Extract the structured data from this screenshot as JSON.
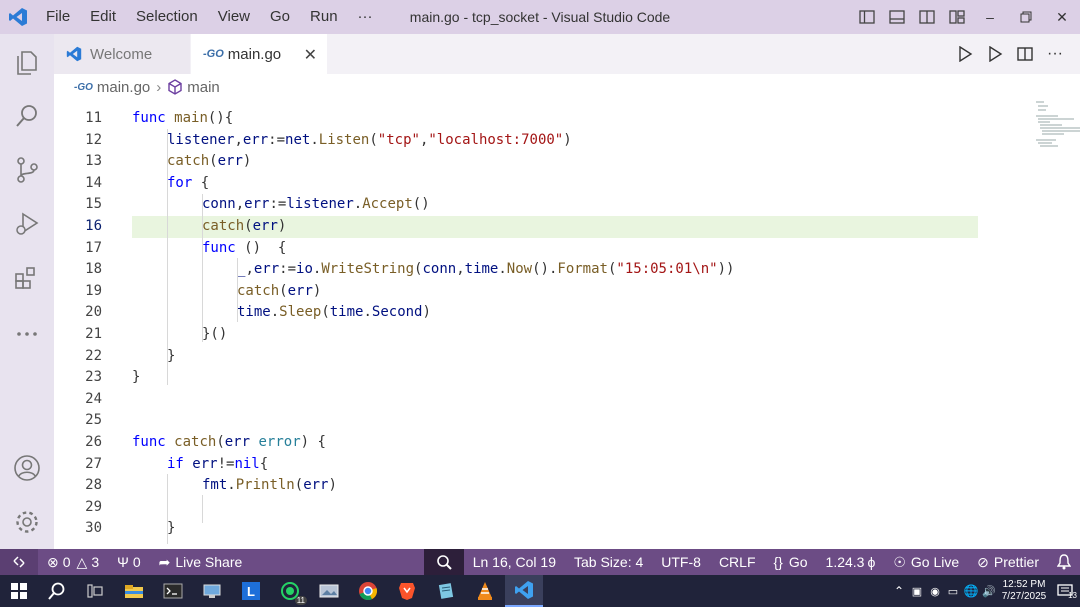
{
  "window": {
    "title": "main.go - tcp_socket - Visual Studio Code",
    "menu": [
      "File",
      "Edit",
      "Selection",
      "View",
      "Go",
      "Run",
      "···"
    ]
  },
  "tabs": [
    {
      "label": "Welcome",
      "active": false
    },
    {
      "label": "main.go",
      "active": true
    }
  ],
  "breadcrumb": {
    "file": "main.go",
    "symbol": "main"
  },
  "editor": {
    "active_line": 16,
    "lines": [
      {
        "n": "11",
        "indent": 0,
        "tokens": [
          [
            "kw",
            "func "
          ],
          [
            "fn",
            "main"
          ],
          [
            "",
            "(){"
          ]
        ]
      },
      {
        "n": "12",
        "indent": 1,
        "tokens": [
          [
            "var",
            "listener"
          ],
          [
            "",
            ","
          ],
          [
            "var",
            "err"
          ],
          [
            "",
            ":="
          ],
          [
            "var",
            "net"
          ],
          [
            "",
            "."
          ],
          [
            "fn",
            "Listen"
          ],
          [
            "",
            "("
          ],
          [
            "str",
            "\"tcp\""
          ],
          [
            "",
            ","
          ],
          [
            "str",
            "\"localhost:7000\""
          ],
          [
            "",
            ")"
          ]
        ]
      },
      {
        "n": "13",
        "indent": 1,
        "tokens": [
          [
            "fn",
            "catch"
          ],
          [
            "",
            "("
          ],
          [
            "var",
            "err"
          ],
          [
            "",
            ")"
          ]
        ]
      },
      {
        "n": "14",
        "indent": 1,
        "tokens": [
          [
            "kw",
            "for"
          ],
          [
            "",
            " {"
          ]
        ]
      },
      {
        "n": "15",
        "indent": 2,
        "tokens": [
          [
            "var",
            "conn"
          ],
          [
            "",
            ","
          ],
          [
            "var",
            "err"
          ],
          [
            "",
            ":="
          ],
          [
            "var",
            "listener"
          ],
          [
            "",
            "."
          ],
          [
            "fn",
            "Accept"
          ],
          [
            "",
            "()"
          ]
        ]
      },
      {
        "n": "16",
        "indent": 2,
        "tokens": [
          [
            "fn",
            "catch"
          ],
          [
            "",
            "("
          ],
          [
            "var",
            "err"
          ],
          [
            "",
            ")"
          ]
        ]
      },
      {
        "n": "17",
        "indent": 2,
        "tokens": [
          [
            "kw",
            "func"
          ],
          [
            "",
            " ()  {"
          ]
        ]
      },
      {
        "n": "18",
        "indent": 3,
        "tokens": [
          [
            "var",
            "_"
          ],
          [
            "",
            ","
          ],
          [
            "var",
            "err"
          ],
          [
            "",
            ":="
          ],
          [
            "var",
            "io"
          ],
          [
            "",
            "."
          ],
          [
            "fn",
            "WriteString"
          ],
          [
            "",
            "("
          ],
          [
            "var",
            "conn"
          ],
          [
            "",
            ","
          ],
          [
            "var",
            "time"
          ],
          [
            "",
            "."
          ],
          [
            "fn",
            "Now"
          ],
          [
            "",
            "()."
          ],
          [
            "fn",
            "Format"
          ],
          [
            "",
            "("
          ],
          [
            "str",
            "\"15:05:01\\n\""
          ],
          [
            "",
            "))"
          ]
        ]
      },
      {
        "n": "19",
        "indent": 3,
        "tokens": [
          [
            "fn",
            "catch"
          ],
          [
            "",
            "("
          ],
          [
            "var",
            "err"
          ],
          [
            "",
            ")"
          ]
        ]
      },
      {
        "n": "20",
        "indent": 3,
        "tokens": [
          [
            "var",
            "time"
          ],
          [
            "",
            "."
          ],
          [
            "fn",
            "Sleep"
          ],
          [
            "",
            "("
          ],
          [
            "var",
            "time"
          ],
          [
            "",
            "."
          ],
          [
            "var",
            "Second"
          ],
          [
            "",
            ")"
          ]
        ]
      },
      {
        "n": "21",
        "indent": 2,
        "tokens": [
          [
            "",
            "}()"
          ]
        ]
      },
      {
        "n": "22",
        "indent": 1,
        "tokens": [
          [
            "",
            "}"
          ]
        ]
      },
      {
        "n": "23",
        "indent": 0,
        "tokens": [
          [
            "",
            "}"
          ]
        ]
      },
      {
        "n": "24",
        "indent": 0,
        "tokens": []
      },
      {
        "n": "25",
        "indent": 0,
        "tokens": []
      },
      {
        "n": "26",
        "indent": 0,
        "tokens": [
          [
            "kw",
            "func "
          ],
          [
            "fn",
            "catch"
          ],
          [
            "",
            "("
          ],
          [
            "var",
            "err"
          ],
          [
            "",
            " "
          ],
          [
            "pkg",
            "error"
          ],
          [
            "",
            ") {"
          ]
        ]
      },
      {
        "n": "27",
        "indent": 1,
        "tokens": [
          [
            "kw",
            "if "
          ],
          [
            "var",
            "err"
          ],
          [
            "",
            "!="
          ],
          [
            "kw",
            "nil"
          ],
          [
            "",
            "{"
          ]
        ]
      },
      {
        "n": "28",
        "indent": 2,
        "tokens": [
          [
            "var",
            "fmt"
          ],
          [
            "",
            "."
          ],
          [
            "fn",
            "Println"
          ],
          [
            "",
            "("
          ],
          [
            "var",
            "err"
          ],
          [
            "",
            ")"
          ]
        ]
      },
      {
        "n": "29",
        "indent": 0,
        "tokens": []
      },
      {
        "n": "30",
        "indent": 1,
        "tokens": [
          [
            "",
            "}"
          ]
        ]
      }
    ]
  },
  "statusbar": {
    "errors": "0",
    "warnings": "3",
    "ports": "0",
    "live_share": "Live Share",
    "position": "Ln 16, Col 19",
    "tab_size": "Tab Size: 4",
    "encoding": "UTF-8",
    "eol": "CRLF",
    "language": "Go",
    "go_version": "1.24.3",
    "go_live": "Go Live",
    "prettier": "Prettier"
  },
  "taskbar": {
    "time": "12:52 PM",
    "date": "7/27/2025",
    "whatsapp_badge": "11",
    "notification_count": "13"
  },
  "colors": {
    "titlebar": "#dcd0e6",
    "statusbar": "#6c4c85",
    "active_line": "#e9f5df",
    "taskbar": "#20233a"
  }
}
